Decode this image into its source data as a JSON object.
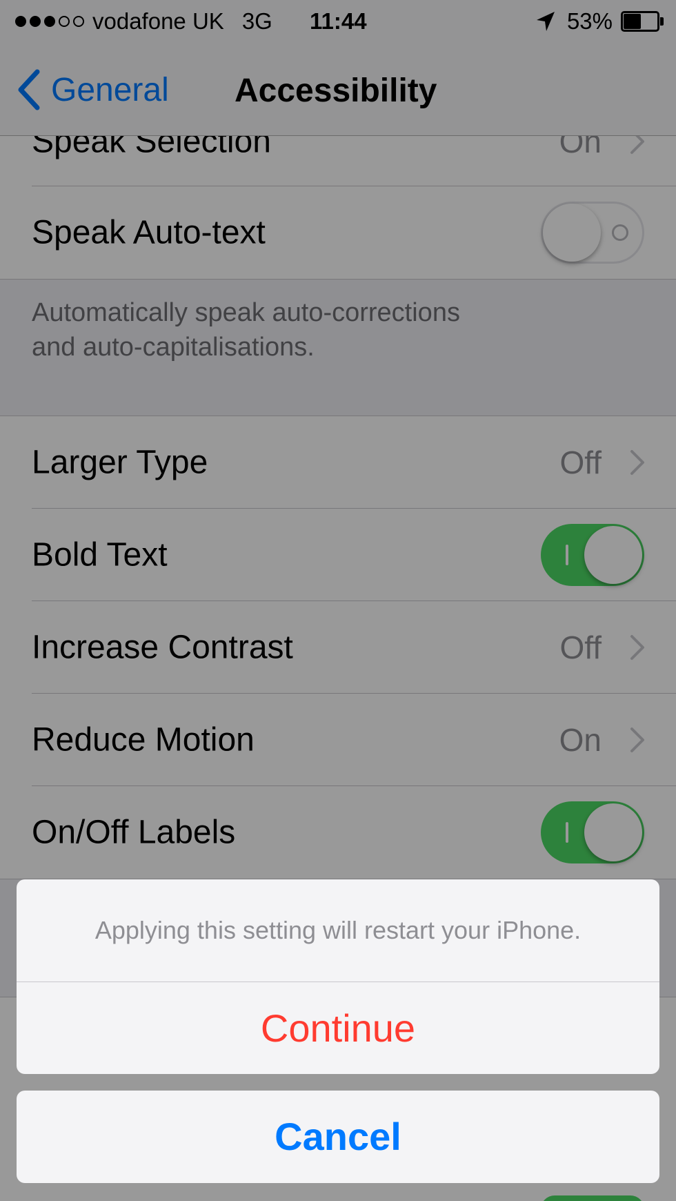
{
  "status_bar": {
    "carrier": "vodafone UK",
    "network": "3G",
    "time": "11:44",
    "battery_percent": "53%",
    "battery_level": 0.53,
    "signal_bars_filled": 3,
    "signal_bars_total": 5
  },
  "nav": {
    "back_label": "General",
    "title": "Accessibility"
  },
  "rows": {
    "speak_selection": {
      "label": "Speak Selection",
      "value": "On"
    },
    "speak_auto_text": {
      "label": "Speak Auto-text",
      "switch_on": false
    },
    "larger_type": {
      "label": "Larger Type",
      "value": "Off"
    },
    "bold_text": {
      "label": "Bold Text",
      "switch_on": true
    },
    "increase_contrast": {
      "label": "Increase Contrast",
      "value": "Off"
    },
    "reduce_motion": {
      "label": "Reduce Motion",
      "value": "On"
    },
    "on_off_labels": {
      "label": "On/Off Labels",
      "switch_on": true
    }
  },
  "footer": {
    "auto_text_line1": "Automatically speak auto-corrections",
    "auto_text_line2": "and auto-capitalisations."
  },
  "action_sheet": {
    "message": "Applying this setting will restart your iPhone.",
    "continue_label": "Continue",
    "cancel_label": "Cancel"
  },
  "colors": {
    "ios_blue": "#007aff",
    "destructive_red": "#ff3b30",
    "switch_green": "#4cd964"
  },
  "icons": [
    "chevron-left-icon",
    "chevron-right-icon",
    "location-arrow-icon",
    "battery-icon"
  ]
}
